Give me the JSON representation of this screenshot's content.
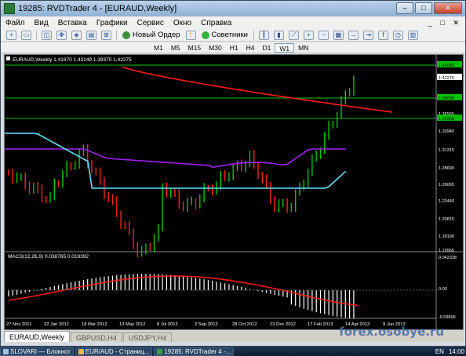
{
  "window": {
    "title": "19285: RVDTrader 4 - [EURAUD,Weekly]"
  },
  "menu": {
    "items": [
      "Файл",
      "Вид",
      "Вставка",
      "Графики",
      "Сервис",
      "Окно",
      "Справка"
    ]
  },
  "toolbar": {
    "new_order": "Новый Ордер",
    "advisors": "Советники",
    "timeframes": [
      "M1",
      "M5",
      "M15",
      "M30",
      "H1",
      "H4",
      "D1",
      "W1",
      "MN"
    ],
    "active_timeframe": "W1"
  },
  "chart": {
    "header": "EURAUD,Weekly  1.41870 1.43149 1.39370 1.42275",
    "price_labels": [
      "1.44089",
      "1.42275",
      "1.39099",
      "1.36565",
      "1.36266",
      "1.33940",
      "1.31315",
      "1.28690",
      "1.26065",
      "1.23440",
      "1.20815",
      "1.18190",
      "1.15565"
    ],
    "macd_header": "MACD(12,26,9) 0.038765 0.019392",
    "macd_labels": [
      "0.042328",
      "0.00",
      "-0.03606"
    ],
    "dates": [
      "27 Nov 2011",
      "22 Jan 2012",
      "18 Mar 2012",
      "13 May 2012",
      "8 Jul 2012",
      "2 Sep 2012",
      "28 Oct 2012",
      "23 Dec 2012",
      "17 Feb 2013",
      "14 Apr 2013",
      "9 Jun 2013"
    ],
    "colors": {
      "bull": "#00c800",
      "bear": "#ff2020",
      "ma_slow": "#ff1a1a",
      "ma_cyan": "#66e0ff",
      "ma_purple": "#a020f0",
      "level": "#00ff00"
    }
  },
  "tabs": [
    "EURAUD,Weekly",
    "GBPUSD,H4",
    "USDJPY,H4"
  ],
  "taskbar": {
    "items": [
      "SLOVARI — Блокнот",
      "EUR/AUD - Страниц...",
      "19285: RVDTrader 4 -..."
    ],
    "lang": "EN",
    "time": "14:00"
  },
  "watermark": "forex.osobye.ru"
}
